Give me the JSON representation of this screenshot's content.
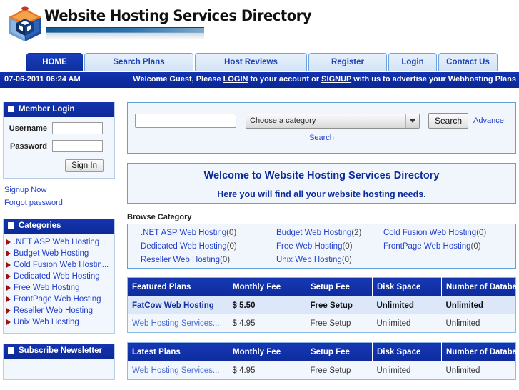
{
  "header": {
    "logo_icon": "cube-box-icon",
    "site_title": "Website Hosting Services Directory"
  },
  "nav": {
    "tabs": [
      {
        "label": "HOME",
        "active": true
      },
      {
        "label": "Search Plans",
        "active": false
      },
      {
        "label": "Host Reviews",
        "active": false
      },
      {
        "label": "Register",
        "active": false
      },
      {
        "label": "Login",
        "active": false
      },
      {
        "label": "Contact Us",
        "active": false
      }
    ]
  },
  "infobar": {
    "datetime": "07-06-2011 06:24 AM",
    "welcome_prefix": "Welcome Guest, Please ",
    "login_link": "LOGIN",
    "welcome_mid": " to your account or ",
    "signup_link": "SIGNUP",
    "welcome_suffix": " with us to advertise your Webhosting Plans"
  },
  "sidebar": {
    "member_login": {
      "title": "Member Login",
      "username_label": "Username",
      "username_value": "",
      "password_label": "Password",
      "password_value": "",
      "signin_button": "Sign In",
      "signup_link": "Signup Now",
      "forgot_link": "Forgot password"
    },
    "categories": {
      "title": "Categories",
      "items": [
        {
          "label": ".NET ASP Web Hosting"
        },
        {
          "label": "Budget Web Hosting"
        },
        {
          "label": "Cold Fusion Web Hostin..."
        },
        {
          "label": "Dedicated Web Hosting"
        },
        {
          "label": "Free Web Hosting"
        },
        {
          "label": "FrontPage Web Hosting"
        },
        {
          "label": "Reseller Web Hosting"
        },
        {
          "label": "Unix Web Hosting"
        }
      ]
    },
    "newsletter": {
      "title": "Subscribe Newsletter"
    }
  },
  "main": {
    "search": {
      "keyword_value": "",
      "keyword_placeholder": "",
      "category_selected": "Choose a category",
      "search_button": "Search",
      "advance_link": "Advance",
      "search_sub_link": "Search"
    },
    "welcome": {
      "line1": "Welcome to Website Hosting Services Directory",
      "line2": "Here you will find all your website hosting needs."
    },
    "browse": {
      "title": "Browse Category",
      "items": [
        {
          "label": ".NET ASP Web Hosting",
          "count": "(0)"
        },
        {
          "label": "Budget Web Hosting",
          "count": "(2)"
        },
        {
          "label": "Cold Fusion Web Hosting",
          "count": "(0)"
        },
        {
          "label": "Dedicated Web Hosting",
          "count": "(0)"
        },
        {
          "label": "Free Web Hosting",
          "count": "(0)"
        },
        {
          "label": "FrontPage Web Hosting",
          "count": "(0)"
        },
        {
          "label": "Reseller Web Hosting",
          "count": "(0)"
        },
        {
          "label": "Unix Web Hosting",
          "count": "(0)"
        }
      ]
    },
    "featured_table": {
      "headers": [
        "Featured Plans",
        "Monthly Fee",
        "Setup Fee",
        "Disk Space",
        "Number of Databases"
      ],
      "rows": [
        {
          "name": "FatCow Web Hosting",
          "monthly_fee": "$ 5.50",
          "setup_fee": "Free Setup",
          "disk_space": "Unlimited",
          "databases": "Unlimited",
          "highlight": true
        },
        {
          "name": "Web Hosting Services...",
          "monthly_fee": "$ 4.95",
          "setup_fee": "Free Setup",
          "disk_space": "Unlimited",
          "databases": "Unlimited",
          "highlight": false
        }
      ]
    },
    "latest_table": {
      "headers": [
        "Latest Plans",
        "Monthly Fee",
        "Setup Fee",
        "Disk Space",
        "Number of Databases"
      ],
      "rows": [
        {
          "name": "Web Hosting Services...",
          "monthly_fee": "$ 4.95",
          "setup_fee": "Free Setup",
          "disk_space": "Unlimited",
          "databases": "Unlimited",
          "highlight": false
        }
      ]
    }
  },
  "colors": {
    "nav_active": "#0f2f9e",
    "nav_tab": "#d3e4f7",
    "header_blue": "#0a2794",
    "link_blue": "#2440cc",
    "panel_border": "#5fa0da",
    "panel_bg": "#f1f6fd",
    "arrow_red": "#9d1111"
  }
}
